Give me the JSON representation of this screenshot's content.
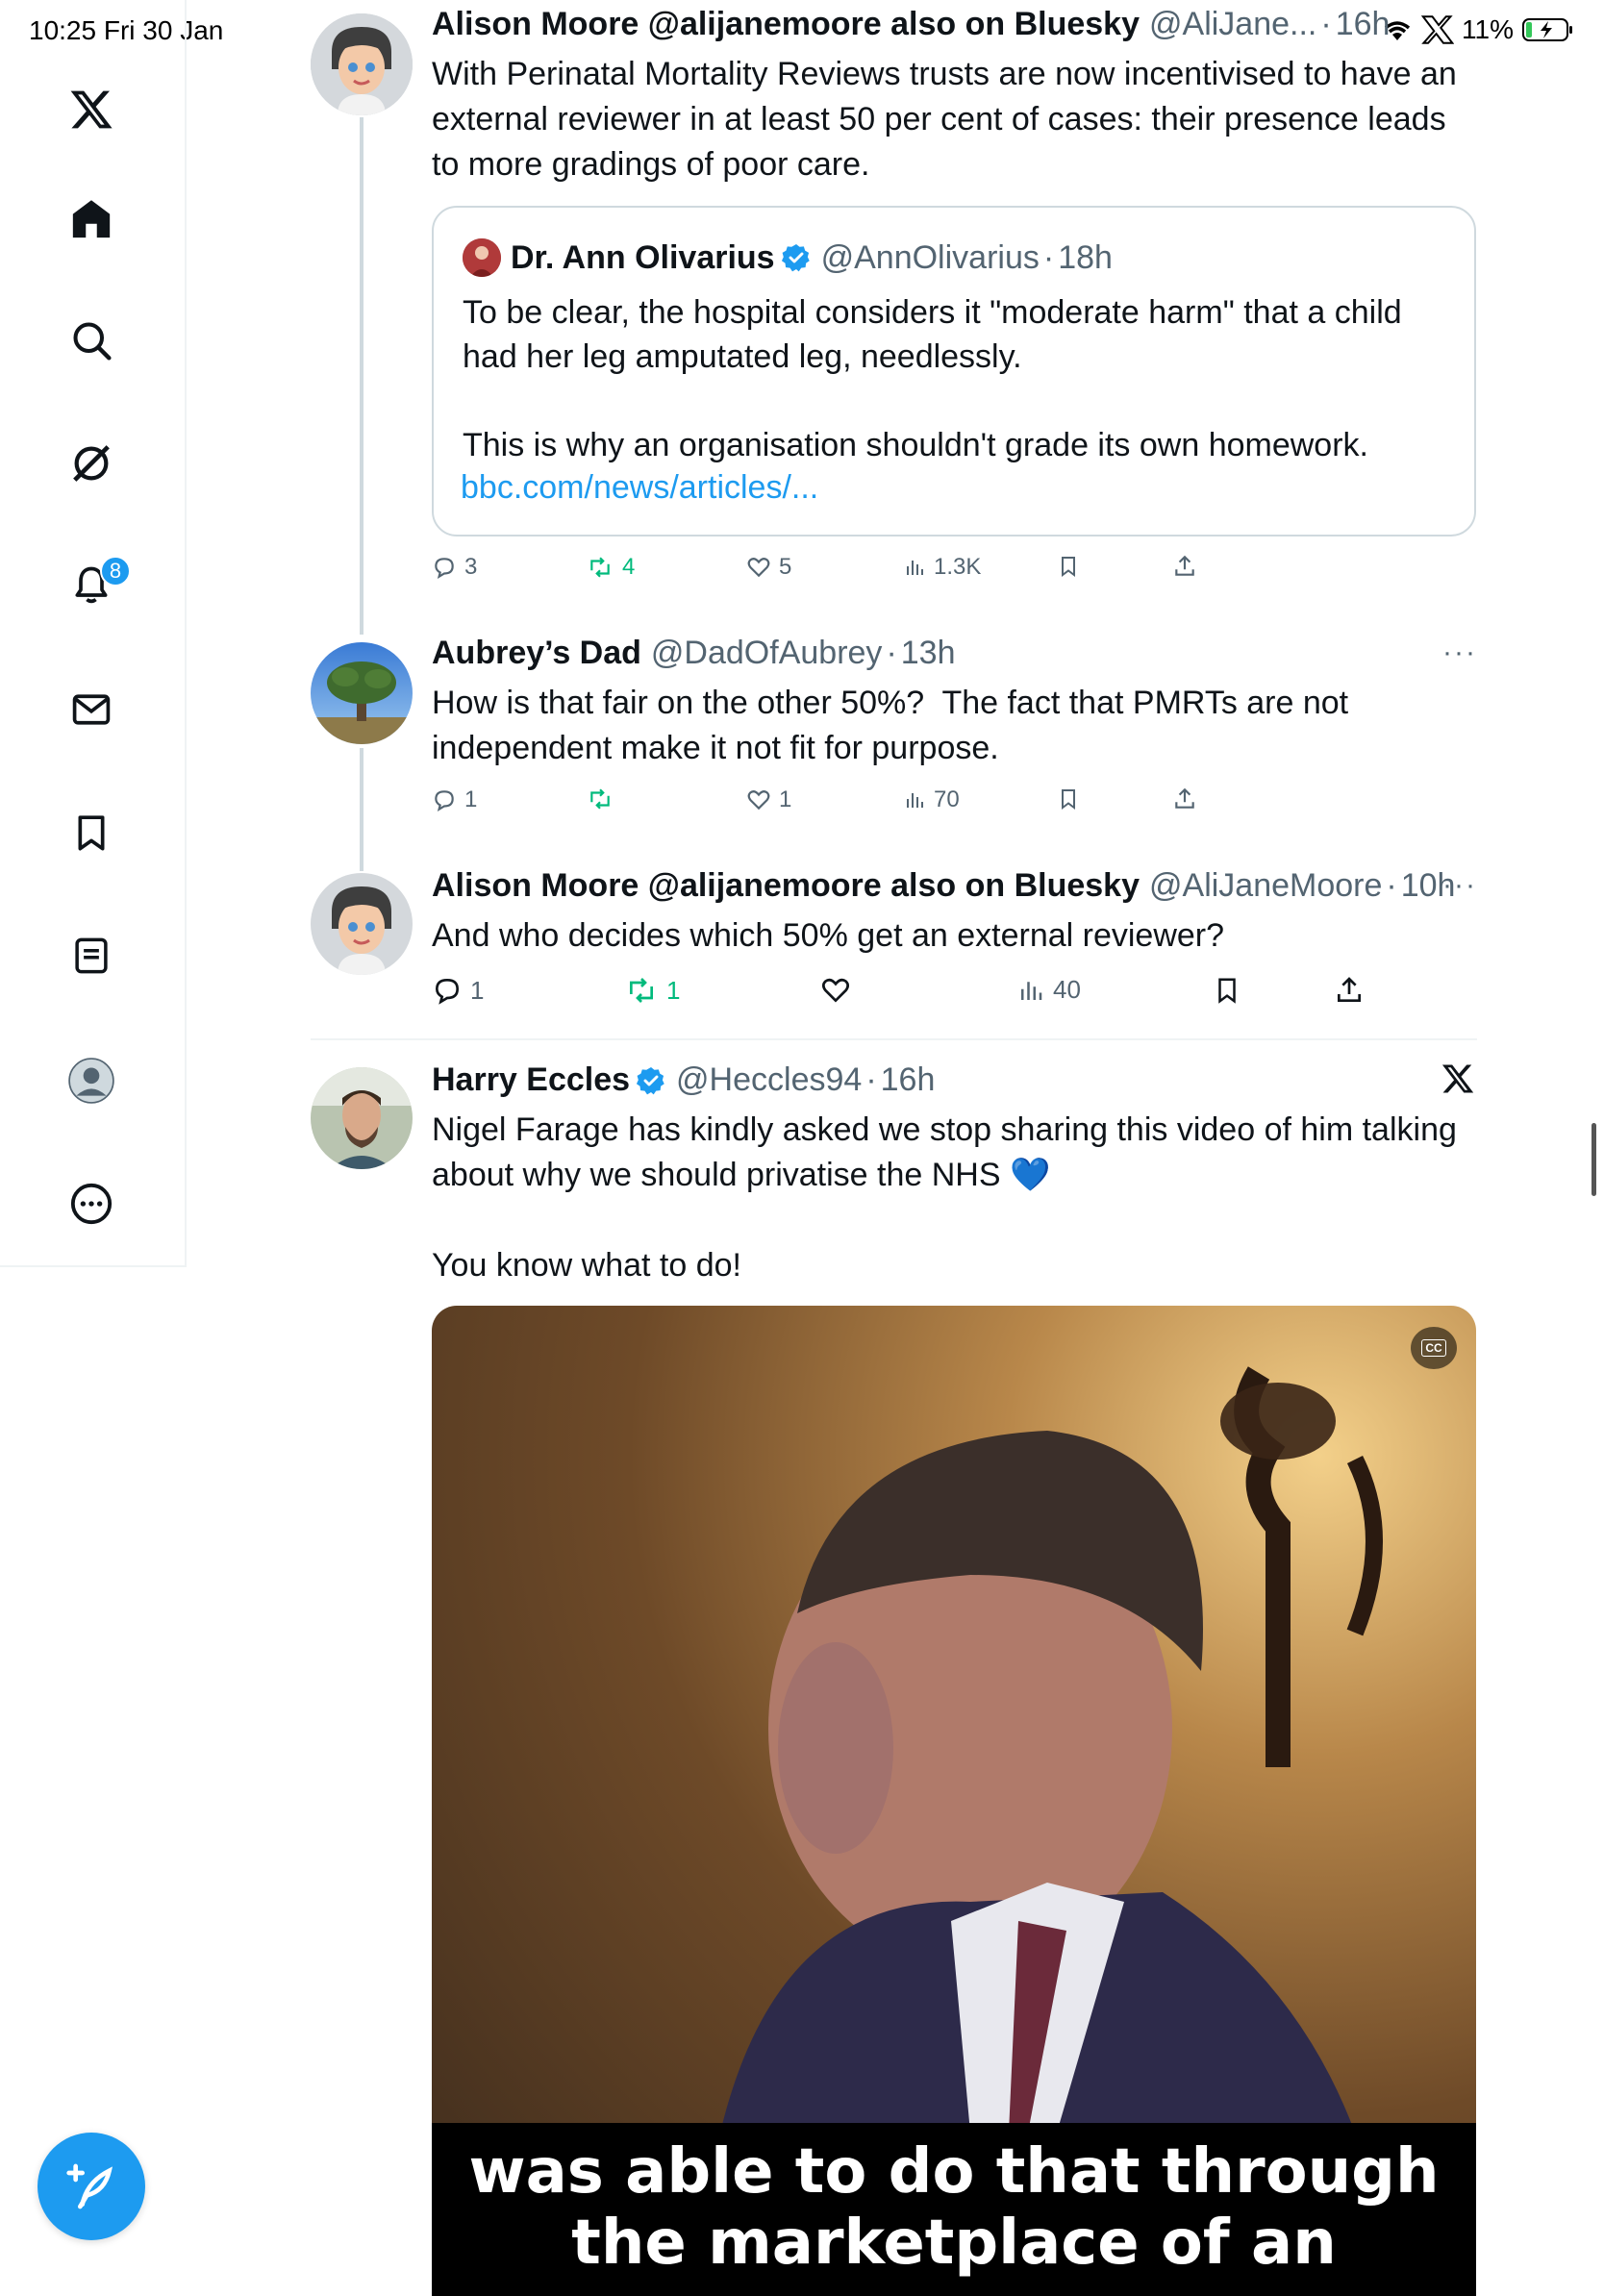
{
  "status_bar": {
    "time": "10:25  Fri 30 Jan",
    "battery": "11%"
  },
  "sidebar": {
    "items": [
      {
        "name": "x-logo"
      },
      {
        "name": "home"
      },
      {
        "name": "search"
      },
      {
        "name": "grok"
      },
      {
        "name": "notifications",
        "badge": "8"
      },
      {
        "name": "messages"
      },
      {
        "name": "bookmarks"
      },
      {
        "name": "lists"
      },
      {
        "name": "profile"
      },
      {
        "name": "more"
      }
    ]
  },
  "tweets": [
    {
      "name": "Alison Moore @alijanemoore also on Bluesky",
      "handle": "@AliJane...",
      "dot": "·",
      "time": "16h",
      "text": "With Perinatal Mortality Reviews trusts are now incentivised to have an external reviewer in at least 50 per cent of cases: their presence leads to more gradings of poor care.",
      "quote": {
        "name": "Dr. Ann Olivarius",
        "handle": "@AnnOlivarius",
        "dot": "·",
        "time": "18h",
        "text": "To be clear, the hospital considers it \"moderate harm\" that a child had her leg amputated leg, needlessly.\n\nThis is why an organisation shouldn't grade its own homework.",
        "link": "bbc.com/news/articles/..."
      },
      "actions": {
        "replies": "3",
        "reposts": "4",
        "likes": "5",
        "views": "1.3K"
      }
    },
    {
      "name": "Aubrey’s Dad",
      "handle": "@DadOfAubrey",
      "dot": "·",
      "time": "13h",
      "more": "···",
      "text": "How is that fair on the other 50%?  The fact that PMRTs are not independent make it not fit for purpose.",
      "actions": {
        "replies": "1",
        "reposts": "",
        "likes": "1",
        "views": "70"
      }
    },
    {
      "name": "Alison Moore @alijanemoore also on Bluesky",
      "handle": "@AliJaneMoore",
      "dot": "·",
      "time": "10h",
      "more": "···",
      "text": "And who decides which 50% get an external reviewer?",
      "actions": {
        "replies": "1",
        "reposts": "1",
        "likes": "",
        "views": "40"
      }
    },
    {
      "name": "Harry Eccles",
      "handle": "@Heccles94",
      "dot": "·",
      "time": "16h",
      "text": "Nigel Farage has kindly asked we stop sharing this video of him talking about why we should privatise the NHS 💙\n\nYou know what to do!",
      "media_caption": "was able to do that through the marketplace of an",
      "cc_label": "CC"
    }
  ],
  "colors": {
    "accent": "#1d9bf0",
    "repost_green": "#00ba7c",
    "secondary_text": "#536471"
  }
}
